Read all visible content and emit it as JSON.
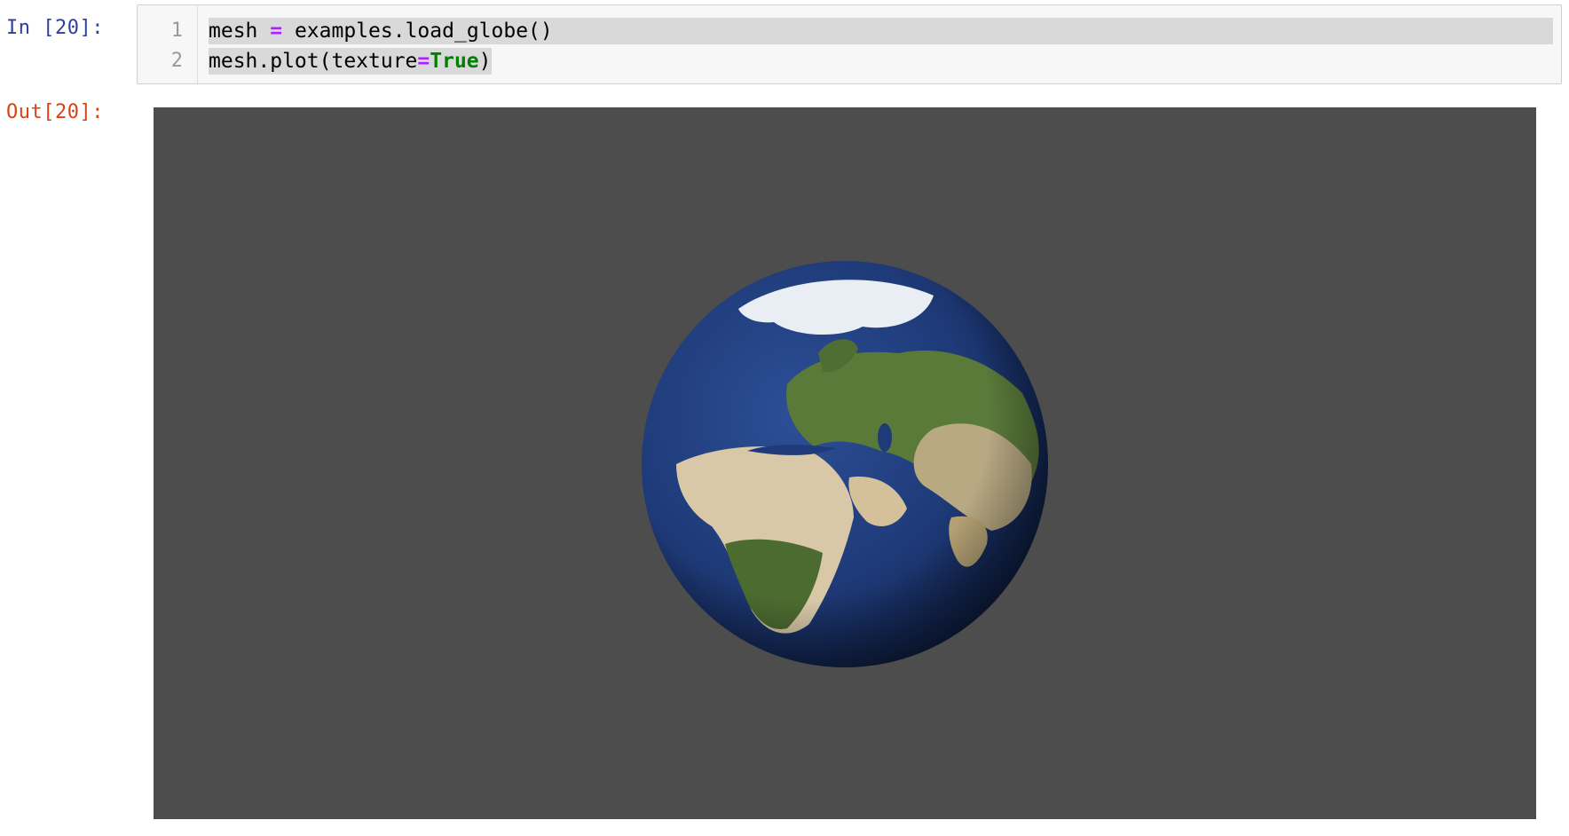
{
  "input_cell": {
    "prompt": "In [20]:",
    "lines": [
      {
        "number": "1",
        "tokens": [
          {
            "text": "mesh ",
            "kind": "plain"
          },
          {
            "text": "=",
            "kind": "op"
          },
          {
            "text": " examples.load_globe()",
            "kind": "plain"
          }
        ]
      },
      {
        "number": "2",
        "tokens": [
          {
            "text": "mesh.plot(texture",
            "kind": "plain"
          },
          {
            "text": "=",
            "kind": "op"
          },
          {
            "text": "True",
            "kind": "kw"
          },
          {
            "text": ")",
            "kind": "plain"
          }
        ]
      }
    ]
  },
  "output_cell": {
    "prompt": "Out[20]:",
    "render": {
      "background_color": "#4d4d4d",
      "object": "textured-earth-globe",
      "ocean_color": "#1e3a78",
      "land_colors": [
        "#d8c8a8",
        "#5a7a3a"
      ],
      "ice_color": "#e8eef4"
    }
  },
  "colors": {
    "in_prompt": "#303f9f",
    "out_prompt": "#d84315",
    "operator": "#aa22ff",
    "keyword": "#008000"
  }
}
